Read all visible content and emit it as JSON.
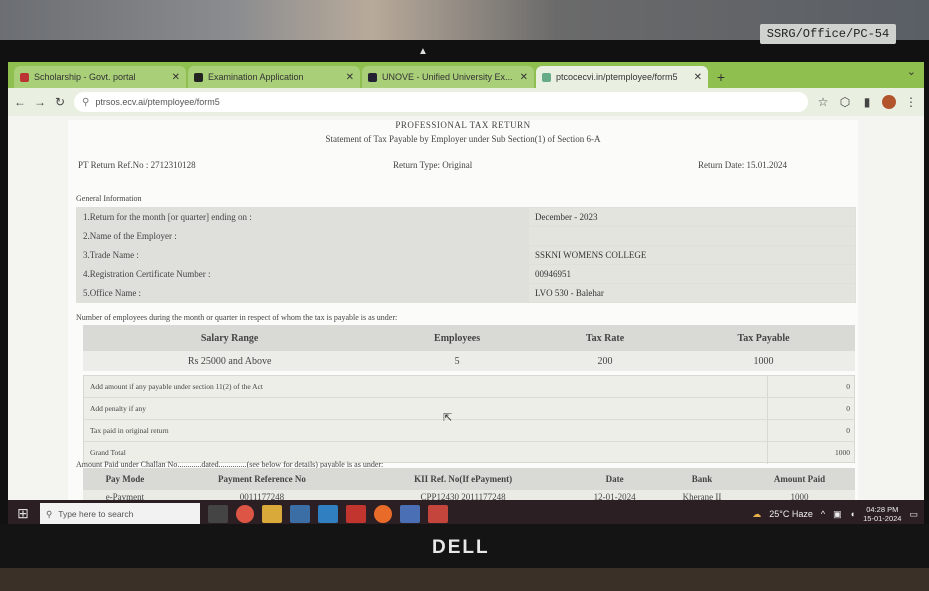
{
  "environment": {
    "wall_sticker": "SSRG/Office/PC-54",
    "monitor_brand": "DELL"
  },
  "browser": {
    "tabs": [
      {
        "label": "Scholarship - Govt. portal",
        "active": false
      },
      {
        "label": "Examination Application",
        "active": false
      },
      {
        "label": "UNOVE - Unified University Ex...",
        "active": false
      },
      {
        "label": "ptcocecvi.in/ptemployee/form5",
        "active": true
      }
    ],
    "new_tab": "+",
    "address": "ptrsos.ecv.ai/ptemployee/form5"
  },
  "form": {
    "title": "PROFESSIONAL TAX RETURN",
    "subtitle": "Statement of Tax Payable by Employer under Sub Section(1) of Section 6-A",
    "return_ref": "PT Return Ref.No : 2712310128",
    "return_type": "Return Type: Original",
    "return_date": "Return Date: 15.01.2024",
    "general_title": "General Information",
    "general": [
      {
        "label": "1.Return for the month [or quarter] ending on :",
        "value": "December - 2023"
      },
      {
        "label": "2.Name of the Employer :",
        "value": ""
      },
      {
        "label": "3.Trade Name :",
        "value": "SSKNI WOMENS COLLEGE"
      },
      {
        "label": "4.Registration Certificate Number :",
        "value": "00946951"
      },
      {
        "label": "5.Office Name :",
        "value": "LVO 530 - Balehar"
      }
    ],
    "employees_title": "Number of employees during the month or quarter in respect of whom the tax is payable is as under:",
    "employee_headers": [
      "Salary Range",
      "Employees",
      "Tax Rate",
      "Tax Payable"
    ],
    "employee_rows": [
      [
        "Rs 25000 and Above",
        "5",
        "200",
        "1000"
      ]
    ],
    "adjustments": [
      {
        "label": "Add amount if any payable under section 11(2) of the Act",
        "value": "0"
      },
      {
        "label": "Add penalty if any",
        "value": "0"
      },
      {
        "label": "Tax paid in original return",
        "value": "0"
      },
      {
        "label": "Grand Total",
        "value": "1000"
      }
    ],
    "challan_title": "Amount Paid under Challan No............dated..............(see below for details) payable is as under:",
    "payment_headers": [
      "Pay Mode",
      "Payment Reference No",
      "KII Ref. No(If ePayment)",
      "Date",
      "Bank",
      "Amount Paid"
    ],
    "payment_rows": [
      [
        "e-Payment",
        "0011177248",
        "CPP12430 2011177248",
        "12-01-2024",
        "Kherane II",
        "1000"
      ]
    ]
  },
  "taskbar": {
    "search_placeholder": "Type here to search",
    "weather": "25°C Haze",
    "time": "04:28 PM",
    "date": "15-01-2024"
  }
}
